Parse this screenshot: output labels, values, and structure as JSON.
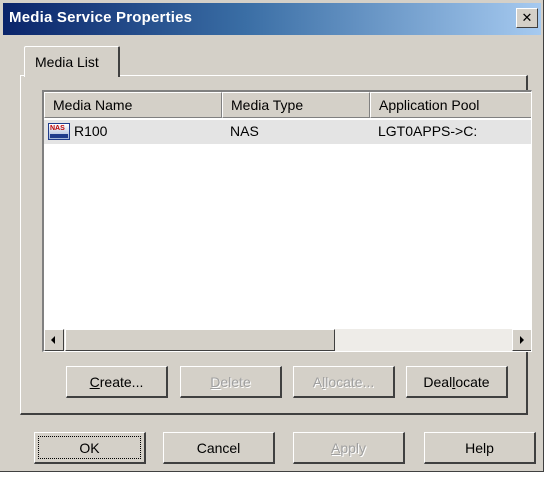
{
  "window": {
    "title": "Media Service Properties",
    "close_glyph": "✕"
  },
  "tabs": [
    {
      "label": "Media List",
      "selected": true
    }
  ],
  "list": {
    "columns": [
      "Media Name",
      "Media Type",
      "Application Pool"
    ],
    "rows": [
      {
        "icon": "nas-media-icon",
        "icon_text": "NAS",
        "name": "R100",
        "type": "NAS",
        "pool": "LGT0APPS->C:"
      }
    ]
  },
  "list_buttons": {
    "create": {
      "pre": "",
      "key": "C",
      "post": "reate...",
      "enabled": true
    },
    "delete": {
      "pre": "",
      "key": "D",
      "post": "elete",
      "enabled": false
    },
    "allocate": {
      "pre": "A",
      "key": "l",
      "post": "locate...",
      "enabled": false
    },
    "deallocate": {
      "pre": "Deal",
      "key": "l",
      "post": "ocate",
      "enabled": true
    }
  },
  "dialog_buttons": {
    "ok": "OK",
    "cancel": "Cancel",
    "apply": {
      "pre": "",
      "key": "A",
      "post": "pply",
      "enabled": false
    },
    "help": "Help"
  }
}
